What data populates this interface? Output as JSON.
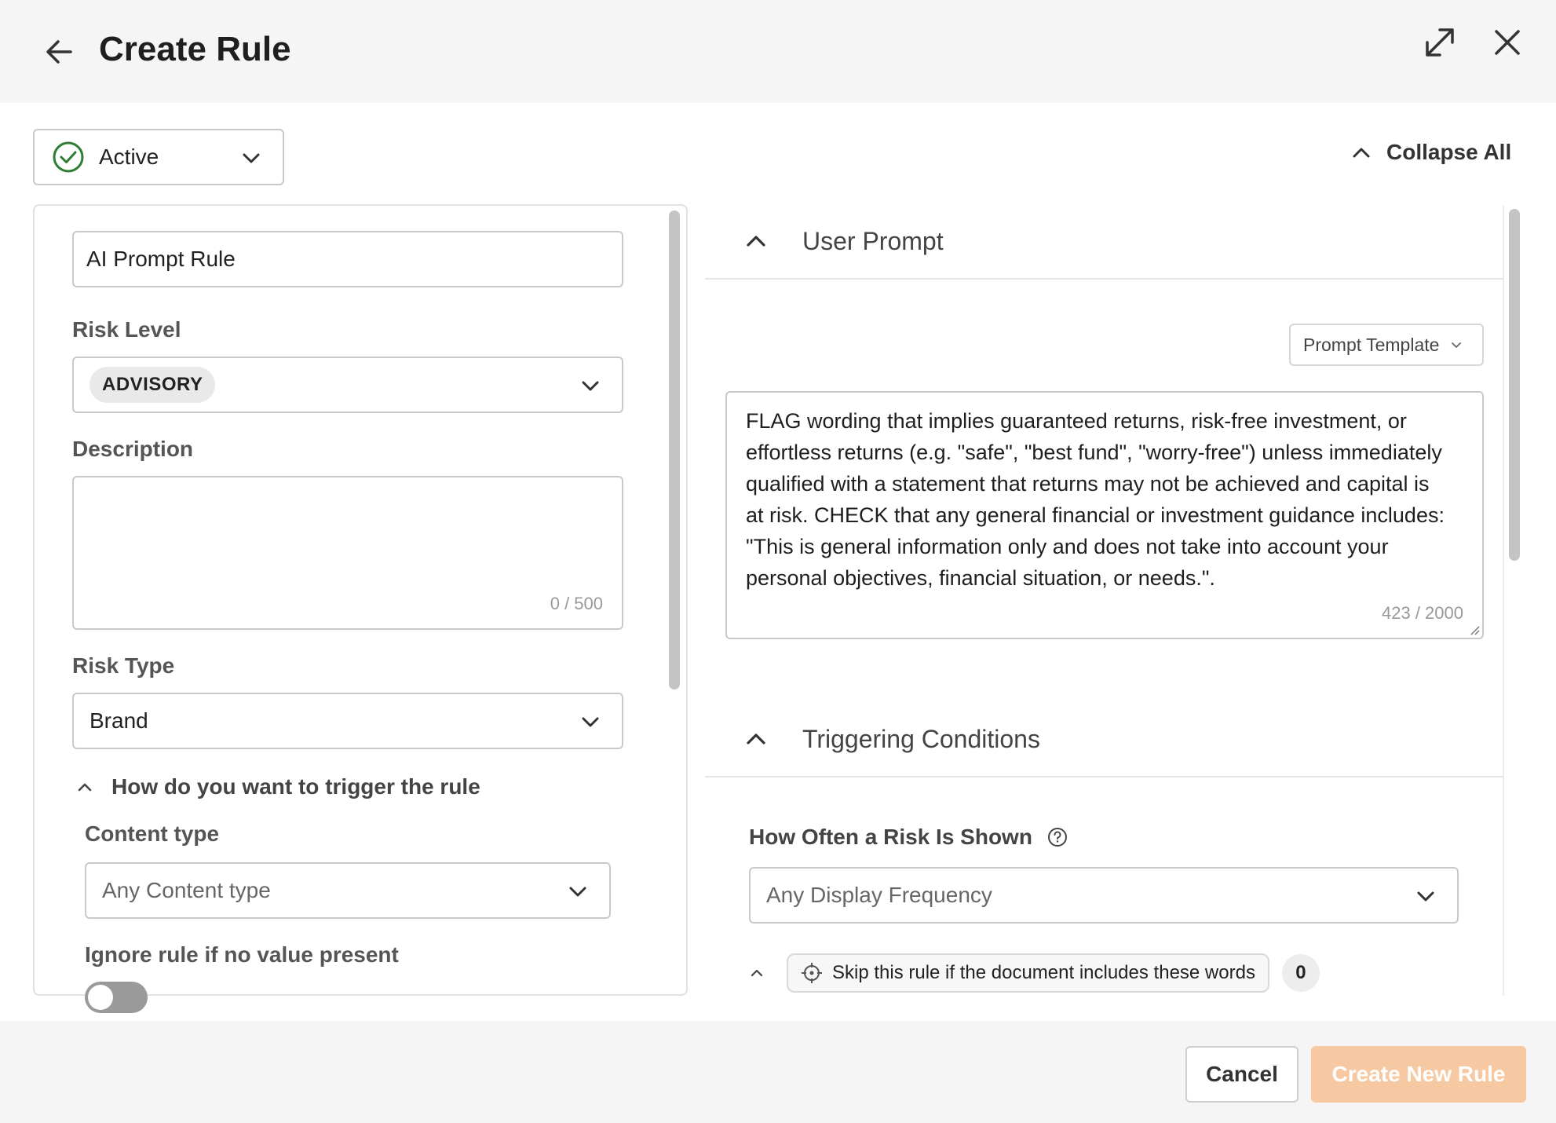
{
  "header": {
    "title": "Create Rule"
  },
  "status": {
    "label": "Active",
    "color": "#2e7d32"
  },
  "toolbar": {
    "collapse_all_label": "Collapse All"
  },
  "left": {
    "rule_name_value": "AI Prompt Rule",
    "risk_level": {
      "label": "Risk Level",
      "value": "ADVISORY"
    },
    "description": {
      "label": "Description",
      "value": "",
      "counter": "0 / 500"
    },
    "risk_type": {
      "label": "Risk Type",
      "value": "Brand"
    },
    "trigger_section": {
      "title": "How do you want to trigger the rule",
      "content_type_label": "Content type",
      "content_type_placeholder": "Any Content type",
      "ignore_label": "Ignore rule if no value present"
    }
  },
  "right": {
    "user_prompt": {
      "title": "User Prompt",
      "template_label": "Prompt Template",
      "text": "FLAG wording that implies guaranteed returns, risk-free investment, or effortless returns (e.g. \"safe\", \"best fund\", \"worry-free\") unless immediately qualified with a statement that returns may not be achieved and capital is at risk. CHECK that any general financial or investment guidance includes: \"This is general information only and does not take into account your personal objectives, financial situation, or needs.\".",
      "counter": "423 / 2000"
    },
    "triggering": {
      "title": "Triggering Conditions",
      "freq_label": "How Often a Risk Is Shown",
      "freq_placeholder": "Any Display Frequency",
      "skip_label": "Skip this rule if the document includes these words",
      "skip_count": "0"
    }
  },
  "footer": {
    "cancel_label": "Cancel",
    "create_label": "Create New Rule",
    "create_color": "#f6c9a3"
  }
}
